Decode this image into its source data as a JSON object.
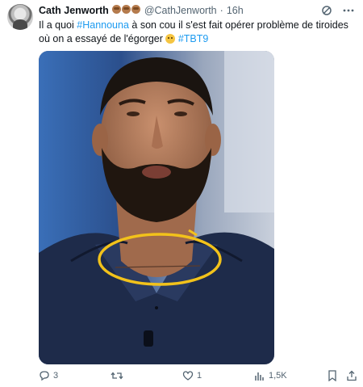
{
  "author": {
    "name": "Cath Jenworth",
    "handle": "@CathJenworth",
    "separator": "·",
    "time": "16h",
    "emojis": [
      "see-no-evil-monkey",
      "see-no-evil-monkey",
      "see-no-evil-monkey"
    ]
  },
  "tweet": {
    "line1_prefix": "Il a quoi ",
    "hashtag1": "#Hannouna",
    "line1_suffix": " à son cou il s'est fait opérer problème de tiroides où on a essayé de l'égorger ",
    "emoji": "thinking-face",
    "hashtag2": "#TBT9"
  },
  "media": {
    "description_icon": "photo",
    "annotation_color": "#f2c21b"
  },
  "actions": {
    "replies": "3",
    "retweets": "",
    "likes": "1",
    "views": "1,5K"
  },
  "colors": {
    "accent": "#1d9bf0",
    "secondary_text": "#536471"
  }
}
